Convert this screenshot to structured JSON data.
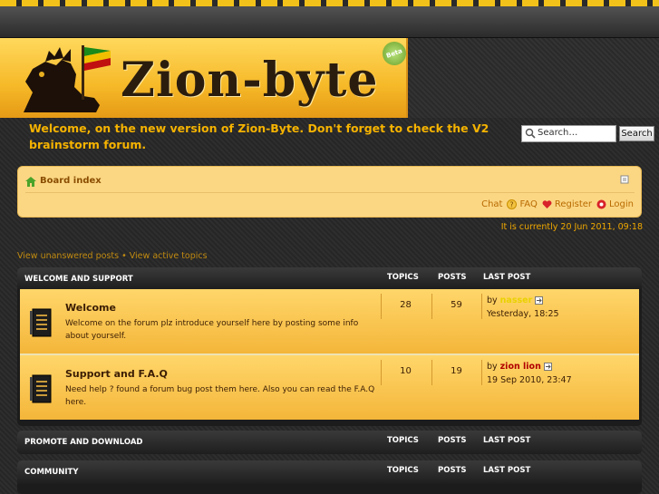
{
  "site": {
    "logo_text": "Zion-byte",
    "beta_badge": "Beta",
    "welcome_message": "Welcome, on the new version of Zion-Byte. Don't forget to check the V2 brainstorm forum."
  },
  "search": {
    "placeholder": "Search…",
    "button_label": "Search"
  },
  "nav": {
    "breadcrumb": "Board index",
    "links": [
      "Chat",
      "FAQ",
      "Register",
      "Login"
    ]
  },
  "current_time": "It is currently 20 Jun 2011, 09:18",
  "search_links": {
    "unanswered": "View unanswered posts",
    "separator": "•",
    "active": "View active topics"
  },
  "columns": {
    "topics": "TOPICS",
    "posts": "POSTS",
    "last_post": "LAST POST"
  },
  "categories": [
    {
      "title": "WELCOME AND SUPPORT",
      "forums": [
        {
          "title": "Welcome",
          "description": "Welcome on the forum plz introduce yourself here by posting some info about yourself.",
          "topics": "28",
          "posts": "59",
          "last_by_prefix": "by",
          "last_by_user": "nasser",
          "last_date": "Yesterday, 18:25",
          "user_color": "#e9d200"
        },
        {
          "title": "Support and F.A.Q",
          "description": "Need help ? found a forum bug post them here. Also you can read the F.A.Q here.",
          "topics": "10",
          "posts": "19",
          "last_by_prefix": "by",
          "last_by_user": "zion lion",
          "last_date": "19 Sep 2010, 23:47",
          "user_color": "#b10000"
        }
      ]
    },
    {
      "title": "PROMOTE AND DOWNLOAD",
      "forums": []
    },
    {
      "title": "COMMUNITY",
      "forums": []
    }
  ]
}
